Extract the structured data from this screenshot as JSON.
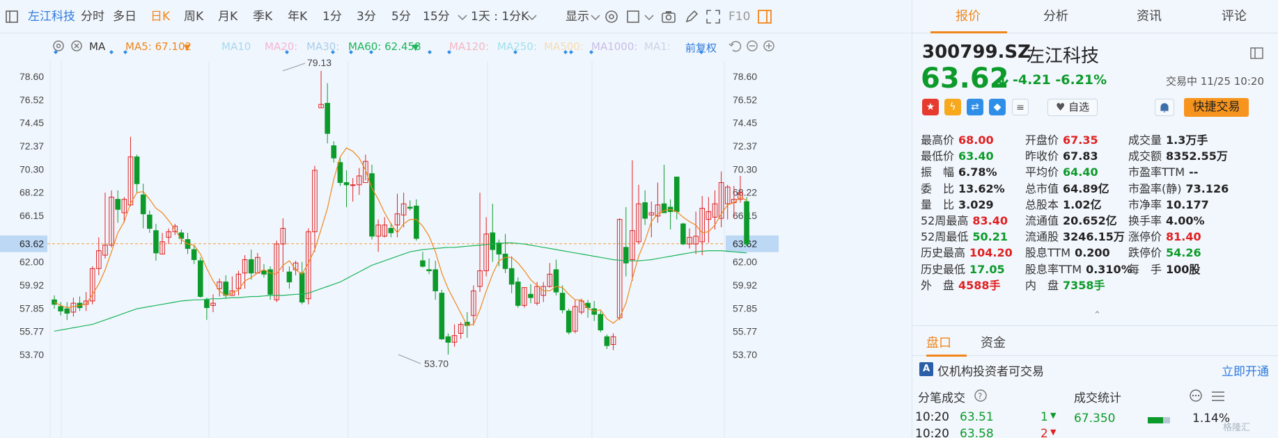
{
  "toolbar": {
    "stock_name": "左江科技",
    "periods": [
      "分时",
      "多日",
      "日K",
      "周K",
      "月K",
      "季K",
      "年K",
      "1分",
      "3分",
      "5分",
      "15分"
    ],
    "active_period": "日K",
    "custom_period": "1天 : 1分K",
    "display_label": "显示",
    "f10_label": "F10"
  },
  "ma_bar": {
    "ma_label": "MA",
    "ma5": "MA5: 67.102",
    "ma10": "MA10",
    "ma20": "MA20:",
    "ma30": "MA30:",
    "ma60": "MA60: 62.458",
    "ma120": "MA120:",
    "ma250": "MA250:",
    "ma500": "MA500:",
    "ma1000": "MA1000:",
    "ma1": "MA1:",
    "adjust": "前复权"
  },
  "colors": {
    "up": "#e02020",
    "down": "#0c9a2a",
    "ma5": "#f0861a",
    "ma60": "#1ab55a",
    "accent": "#f0861a",
    "blue": "#2f7bde"
  },
  "chart_data": {
    "type": "candlestick",
    "y_ticks": [
      "78.60",
      "76.52",
      "74.45",
      "72.37",
      "70.30",
      "68.22",
      "66.15",
      "64.07",
      "62.00",
      "59.92",
      "57.85",
      "55.77",
      "53.70"
    ],
    "ylim": [
      53.7,
      78.6
    ],
    "current_price_label": "63.62",
    "high_annotation": "79.13",
    "low_annotation": "53.70",
    "candles": [
      [
        58.6,
        58.2,
        59.0,
        57.8
      ],
      [
        58.0,
        57.6,
        58.4,
        57.2
      ],
      [
        57.8,
        57.4,
        58.4,
        56.8
      ],
      [
        57.5,
        58.3,
        58.8,
        57.1
      ],
      [
        58.3,
        57.9,
        58.9,
        57.6
      ],
      [
        58.2,
        58.5,
        59.3,
        57.6
      ],
      [
        58.5,
        61.4,
        61.6,
        58.2
      ],
      [
        61.4,
        63.0,
        64.2,
        60.8
      ],
      [
        62.6,
        63.5,
        68.2,
        62.3
      ],
      [
        63.5,
        67.8,
        68.4,
        63.3
      ],
      [
        67.6,
        66.7,
        68.4,
        65.5
      ],
      [
        66.4,
        67.6,
        67.8,
        65.5
      ],
      [
        67.1,
        71.4,
        73.2,
        67.0
      ],
      [
        71.4,
        69.0,
        71.6,
        68.2
      ],
      [
        68.0,
        66.3,
        69.0,
        65.0
      ],
      [
        66.2,
        65.0,
        66.6,
        64.6
      ],
      [
        64.8,
        62.8,
        65.4,
        62.1
      ],
      [
        62.7,
        63.8,
        64.6,
        62.7
      ],
      [
        64.2,
        64.7,
        65.0,
        63.6
      ],
      [
        64.7,
        65.2,
        65.4,
        64.4
      ],
      [
        64.6,
        64.1,
        64.9,
        63.6
      ],
      [
        64.0,
        63.2,
        64.6,
        62.7
      ],
      [
        63.1,
        62.2,
        63.5,
        61.8
      ],
      [
        62.1,
        58.9,
        62.4,
        58.8
      ],
      [
        58.6,
        57.9,
        58.8,
        56.8
      ],
      [
        58.1,
        58.3,
        59.1,
        57.5
      ],
      [
        59.6,
        60.2,
        60.5,
        58.9
      ],
      [
        60.2,
        59.0,
        60.8,
        58.7
      ],
      [
        59.0,
        59.4,
        60.7,
        59.0
      ],
      [
        59.6,
        60.9,
        61.2,
        59.0
      ],
      [
        61.0,
        62.2,
        62.6,
        59.6
      ],
      [
        62.2,
        61.0,
        63.1,
        60.4
      ],
      [
        61.0,
        62.4,
        62.8,
        61.0
      ],
      [
        61.2,
        60.9,
        61.8,
        60.6
      ],
      [
        61.3,
        59.1,
        61.6,
        58.6
      ],
      [
        58.6,
        63.6,
        63.9,
        58.4
      ],
      [
        63.6,
        65.0,
        65.9,
        61.1
      ],
      [
        61.1,
        60.2,
        61.6,
        59.6
      ],
      [
        61.3,
        61.9,
        62.1,
        60.8
      ],
      [
        61.0,
        58.4,
        62.0,
        58.2
      ],
      [
        58.7,
        64.7,
        65.0,
        58.2
      ],
      [
        64.7,
        70.2,
        70.6,
        62.9
      ],
      [
        75.8,
        76.1,
        79.1,
        75.8
      ],
      [
        76.2,
        73.5,
        78.0,
        72.6
      ],
      [
        72.4,
        71.3,
        72.8,
        70.9
      ],
      [
        70.9,
        69.1,
        71.4,
        68.8
      ],
      [
        69.1,
        68.9,
        70.2,
        66.9
      ],
      [
        68.9,
        68.9,
        69.5,
        67.4
      ],
      [
        68.9,
        69.7,
        70.4,
        68.0
      ],
      [
        69.1,
        71.0,
        71.6,
        69.3
      ],
      [
        69.9,
        64.3,
        70.7,
        64.0
      ],
      [
        64.3,
        65.3,
        65.8,
        62.9
      ],
      [
        64.3,
        65.3,
        66.0,
        64.2
      ],
      [
        65.0,
        64.6,
        65.5,
        64.2
      ],
      [
        65.3,
        66.3,
        68.1,
        64.2
      ],
      [
        66.2,
        67.2,
        68.2,
        65.1
      ],
      [
        66.9,
        66.8,
        67.5,
        66.6
      ],
      [
        67.0,
        64.1,
        67.6,
        63.9
      ],
      [
        62.1,
        61.6,
        62.9,
        61.5
      ],
      [
        61.3,
        61.2,
        62.3,
        60.9
      ],
      [
        61.3,
        59.4,
        62.1,
        58.6
      ],
      [
        59.2,
        55.1,
        59.5,
        55.0
      ],
      [
        55.3,
        54.8,
        55.6,
        53.7
      ],
      [
        54.8,
        55.4,
        56.4,
        54.4
      ],
      [
        55.6,
        56.4,
        56.6,
        55.1
      ],
      [
        56.6,
        56.3,
        57.5,
        55.2
      ],
      [
        57.2,
        59.4,
        59.9,
        56.3
      ],
      [
        59.8,
        61.2,
        68.2,
        59.3
      ],
      [
        61.2,
        64.5,
        66.0,
        60.7
      ],
      [
        64.6,
        63.1,
        67.2,
        62.0
      ],
      [
        63.7,
        62.7,
        64.0,
        61.6
      ],
      [
        62.7,
        61.4,
        64.5,
        61.0
      ],
      [
        61.4,
        60.0,
        62.5,
        59.2
      ],
      [
        60.2,
        58.1,
        60.6,
        57.9
      ],
      [
        58.1,
        59.7,
        59.7,
        57.9
      ],
      [
        59.1,
        58.8,
        60.0,
        58.3
      ],
      [
        58.3,
        59.8,
        60.2,
        58.1
      ],
      [
        59.0,
        59.8,
        60.2,
        58.4
      ],
      [
        59.8,
        60.9,
        61.9,
        59.7
      ],
      [
        61.3,
        59.3,
        62.2,
        59.0
      ],
      [
        59.2,
        57.7,
        59.9,
        57.4
      ],
      [
        57.6,
        55.7,
        57.8,
        55.5
      ],
      [
        55.8,
        58.0,
        58.6,
        55.6
      ],
      [
        57.5,
        58.5,
        58.7,
        57.3
      ],
      [
        58.3,
        57.9,
        58.6,
        57.0
      ],
      [
        57.8,
        57.3,
        58.5,
        56.7
      ],
      [
        57.3,
        55.9,
        57.6,
        55.7
      ],
      [
        55.3,
        54.5,
        55.5,
        54.2
      ],
      [
        54.6,
        55.3,
        55.6,
        54.1
      ],
      [
        57.0,
        65.8,
        65.9,
        56.8
      ],
      [
        63.3,
        61.9,
        66.9,
        60.7
      ],
      [
        62.2,
        64.8,
        71.1,
        60.3
      ],
      [
        63.8,
        67.2,
        68.9,
        63.6
      ],
      [
        67.3,
        65.9,
        68.4,
        65.3
      ],
      [
        66.2,
        66.4,
        67.4,
        64.2
      ],
      [
        66.1,
        67.1,
        69.1,
        65.5
      ],
      [
        67.2,
        66.4,
        70.7,
        66.4
      ],
      [
        66.9,
        66.5,
        67.6,
        64.9
      ],
      [
        69.6,
        66.5,
        69.6,
        65.8
      ],
      [
        65.4,
        63.6,
        65.5,
        63.5
      ],
      [
        63.6,
        64.2,
        65.0,
        63.2
      ],
      [
        63.6,
        64.3,
        66.5,
        62.7
      ],
      [
        63.8,
        66.8,
        67.9,
        62.6
      ],
      [
        65.8,
        66.5,
        67.8,
        63.7
      ],
      [
        66.0,
        67.2,
        68.4,
        64.9
      ],
      [
        65.9,
        69.1,
        70.1,
        65.1
      ],
      [
        67.2,
        68.7,
        68.9,
        65.8
      ],
      [
        67.3,
        67.6,
        68.8,
        65.9
      ],
      [
        67.6,
        68.2,
        69.7,
        67.3
      ],
      [
        67.4,
        63.6,
        67.8,
        63.4
      ]
    ],
    "ma5": [
      58.4,
      58.1,
      57.9,
      58.0,
      58.1,
      58.2,
      59.1,
      60.0,
      61.3,
      62.9,
      64.6,
      65.6,
      67.2,
      68.2,
      68.3,
      67.6,
      66.8,
      66.4,
      65.7,
      64.9,
      64.0,
      63.6,
      63.5,
      62.7,
      61.4,
      60.3,
      59.4,
      59.0,
      59.2,
      59.5,
      60.3,
      60.6,
      61.0,
      61.3,
      61.0,
      60.9,
      61.7,
      62.1,
      61.3,
      60.9,
      61.9,
      63.1,
      64.9,
      66.8,
      69.4,
      71.4,
      72.2,
      71.9,
      71.3,
      70.2,
      68.6,
      67.6,
      66.4,
      65.4,
      64.6,
      65.4,
      65.8,
      65.8,
      65.2,
      64.3,
      62.9,
      61.0,
      59.6,
      58.5,
      57.4,
      56.3,
      56.4,
      57.7,
      59.4,
      60.9,
      62.1,
      62.4,
      62.4,
      61.9,
      61.2,
      60.4,
      59.9,
      59.4,
      59.4,
      59.8,
      59.7,
      59.1,
      58.6,
      58.6,
      57.8,
      57.6,
      57.7,
      56.9,
      56.5,
      57.0,
      58.3,
      60.5,
      62.5,
      63.9,
      65.6,
      66.3,
      66.6,
      66.7,
      66.5,
      66.0,
      65.6,
      65.3,
      64.6,
      64.7,
      65.3,
      66.3,
      67.1,
      67.3,
      67.8,
      67.5
    ],
    "ma60": [
      55.8,
      55.9,
      56.0,
      56.1,
      56.2,
      56.3,
      56.4,
      56.6,
      56.8,
      57.0,
      57.2,
      57.4,
      57.6,
      57.8,
      57.9,
      58.0,
      58.1,
      58.2,
      58.3,
      58.4,
      58.5,
      58.55,
      58.6,
      58.6,
      58.65,
      58.7,
      58.7,
      58.75,
      58.8,
      58.8,
      58.85,
      58.9,
      58.9,
      58.95,
      59.0,
      59.0,
      59.0,
      59.05,
      59.1,
      59.1,
      59.2,
      59.4,
      59.6,
      59.8,
      60.0,
      60.2,
      60.5,
      60.8,
      61.1,
      61.4,
      61.7,
      61.9,
      62.1,
      62.3,
      62.5,
      62.7,
      62.9,
      63.0,
      63.1,
      63.15,
      63.2,
      63.25,
      63.3,
      63.3,
      63.35,
      63.4,
      63.45,
      63.5,
      63.55,
      63.6,
      63.65,
      63.7,
      63.7,
      63.65,
      63.6,
      63.5,
      63.4,
      63.3,
      63.2,
      63.1,
      63.0,
      62.9,
      62.8,
      62.7,
      62.6,
      62.5,
      62.4,
      62.3,
      62.2,
      62.15,
      62.1,
      62.1,
      62.1,
      62.15,
      62.2,
      62.3,
      62.4,
      62.5,
      62.6,
      62.7,
      62.8,
      62.9,
      62.95,
      63.0,
      63.0,
      63.0,
      62.95,
      62.9,
      62.85,
      62.8
    ]
  },
  "quote": {
    "tabs": [
      "报价",
      "分析",
      "资讯",
      "评论"
    ],
    "code": "300799.SZ",
    "name": "左江科技",
    "price": "63.62",
    "change": "-4.21",
    "change_pct": "-6.21%",
    "status": "交易中 11/25 10:20",
    "watch_label": "自选",
    "trade_label": "快捷交易",
    "rows": [
      [
        [
          "最高价",
          "68.00",
          "red"
        ],
        [
          "开盘价",
          "67.35",
          "red"
        ],
        [
          "成交量",
          "1.3万手",
          "dark"
        ]
      ],
      [
        [
          "最低价",
          "63.40",
          "green"
        ],
        [
          "昨收价",
          "67.83",
          "dark"
        ],
        [
          "成交额",
          "8352.55万",
          "dark"
        ]
      ],
      [
        [
          "振　幅",
          "6.78%",
          "dark"
        ],
        [
          "平均价",
          "64.40",
          "green"
        ],
        [
          "市盈率TTM",
          "--",
          "dark"
        ]
      ],
      [
        [
          "委　比",
          "13.62%",
          "dark"
        ],
        [
          "总市值",
          "64.89亿",
          "dark"
        ],
        [
          "市盈率(静)",
          "73.126",
          "dark"
        ]
      ],
      [
        [
          "量　比",
          "3.029",
          "dark"
        ],
        [
          "总股本",
          "1.02亿",
          "dark"
        ],
        [
          "市净率",
          "10.177",
          "dark"
        ]
      ],
      [
        [
          "52周最高",
          "83.40",
          "red"
        ],
        [
          "流通值",
          "20.652亿",
          "dark"
        ],
        [
          "换手率",
          "4.00%",
          "dark"
        ]
      ],
      [
        [
          "52周最低",
          "50.21",
          "green"
        ],
        [
          "流通股",
          "3246.15万",
          "dark"
        ],
        [
          "涨停价",
          "81.40",
          "red"
        ]
      ],
      [
        [
          "历史最高",
          "104.20",
          "red"
        ],
        [
          "股息TTM",
          "0.200",
          "dark"
        ],
        [
          "跌停价",
          "54.26",
          "green"
        ]
      ],
      [
        [
          "历史最低",
          "17.05",
          "green"
        ],
        [
          "股息率TTM",
          "0.310%",
          "dark"
        ],
        [
          "每　手",
          "100股",
          "dark"
        ]
      ],
      [
        [
          "外　盘",
          "4588手",
          "red"
        ],
        [
          "内　盘",
          "7358手",
          "green"
        ],
        [
          "",
          "",
          " "
        ]
      ]
    ],
    "subtabs": [
      "盘口",
      "资金"
    ],
    "notice_text": "仅机构投资者可交易",
    "notice_link": "立即开通",
    "trades_title": "分笔成交",
    "stats_title": "成交统计",
    "trades": [
      [
        "10:20",
        "63.51",
        "1"
      ],
      [
        "10:20",
        "63.58",
        "2"
      ]
    ],
    "stat_value": "67.350",
    "stat_pct": "1.14%",
    "watermark": "格隆汇"
  }
}
